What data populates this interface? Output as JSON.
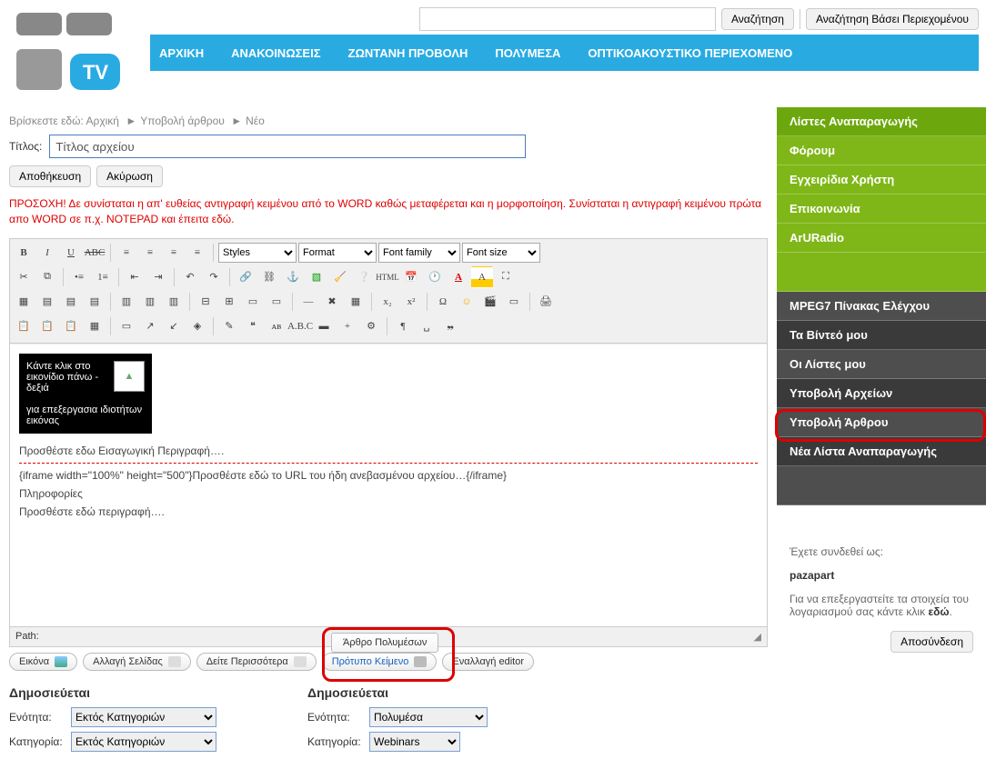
{
  "search": {
    "placeholder": "",
    "button": "Αναζήτηση",
    "content_button": "Αναζήτηση Βάσει Περιεχομένου"
  },
  "nav": {
    "home": "ΑΡΧΙΚΗ",
    "ann": "ΑΝΑΚΟΙΝΩΣΕΙΣ",
    "live": "ΖΩΝΤΑΝΗ ΠΡΟΒΟΛΗ",
    "mm": "ΠΟΛΥΜΕΣΑ",
    "av": "ΟΠΤΙΚΟΑΚΟΥΣΤΙΚΟ ΠΕΡΙΕΧΟΜΕΝΟ"
  },
  "crumb": {
    "prefix": "Βρίσκεστε εδώ: ",
    "home": "Αρχική",
    "submit": "Υποβολή άρθρου",
    "new": "Νέο"
  },
  "title": {
    "label": "Τίτλος:",
    "value": "Τίτλος αρχείου"
  },
  "actions": {
    "save": "Αποθήκευση",
    "cancel": "Ακύρωση"
  },
  "warn": "ΠΡΟΣΟΧΗ! Δε συνίσταται η απ' ευθείας αντιγραφή κειμένου από το WORD καθώς μεταφέρεται και η μορφοποίηση. Συνίσταται η αντιγραφή κειμένου πρώτα απο WORD σε π.χ. NOTEPAD και έπειτα εδώ.",
  "tb": {
    "styles": "Styles",
    "format": "Format",
    "family": "Font family",
    "size": "Font size"
  },
  "canvas": {
    "thumbtext": "Κάντε κλικ στο εικονίδιο πάνω - δεξιά\n\nγια επεξεργασια ιδιοτήτων εικόνας",
    "intro": "Προσθέστε εδω Εισαγωγική Περιγραφή….",
    "iframe": "{iframe width=\"100%\" height=\"500\"}Προσθέστε εδώ το URL του ήδη ανεβασμένου αρχείου…{/iframe}",
    "info": "Πληροφορίες",
    "desc": "Προσθέστε εδώ περιγραφή…."
  },
  "path": "Path:",
  "chips": {
    "image": "Εικόνα",
    "pagebreak": "Αλλαγή Σελίδας",
    "readmore": "Δείτε Περισσότερα",
    "template": "Πρότυπο Κείμενο",
    "toggle": "Εναλλαγή editor",
    "tooltip": "Άρθρο Πολυμέσων"
  },
  "pub": {
    "title": "Δημοσιεύεται",
    "sectlbl": "Ενότητα:",
    "catlbl": "Κατηγορία:",
    "left_sect": "Εκτός Κατηγοριών",
    "left_cat": "Εκτός Κατηγοριών",
    "right_sect": "Πολυμέσα",
    "right_cat": "Webinars"
  },
  "side_green": [
    "Λίστες Αναπαραγωγής",
    "Φόρουμ",
    "Εγχειρίδια Χρήστη",
    "Επικοινωνία",
    "ArURadio"
  ],
  "side_grey": [
    "MPEG7 Πίνακας Ελέγχου",
    "Τα Βίντεό μου",
    "Οι Λίστες μου",
    "Υποβολή Αρχείων",
    "Υποβολή Άρθρου",
    "Νέα Λίστα Αναπαραγωγής"
  ],
  "user": {
    "loggedas": "Έχετε συνδεθεί ως:",
    "name": "pazapart",
    "edit": "Για να επεξεργαστείτε τα στοιχεία του λογαριασμού σας κάντε κλικ ",
    "here": "εδώ",
    "logout": "Αποσύνδεση"
  }
}
